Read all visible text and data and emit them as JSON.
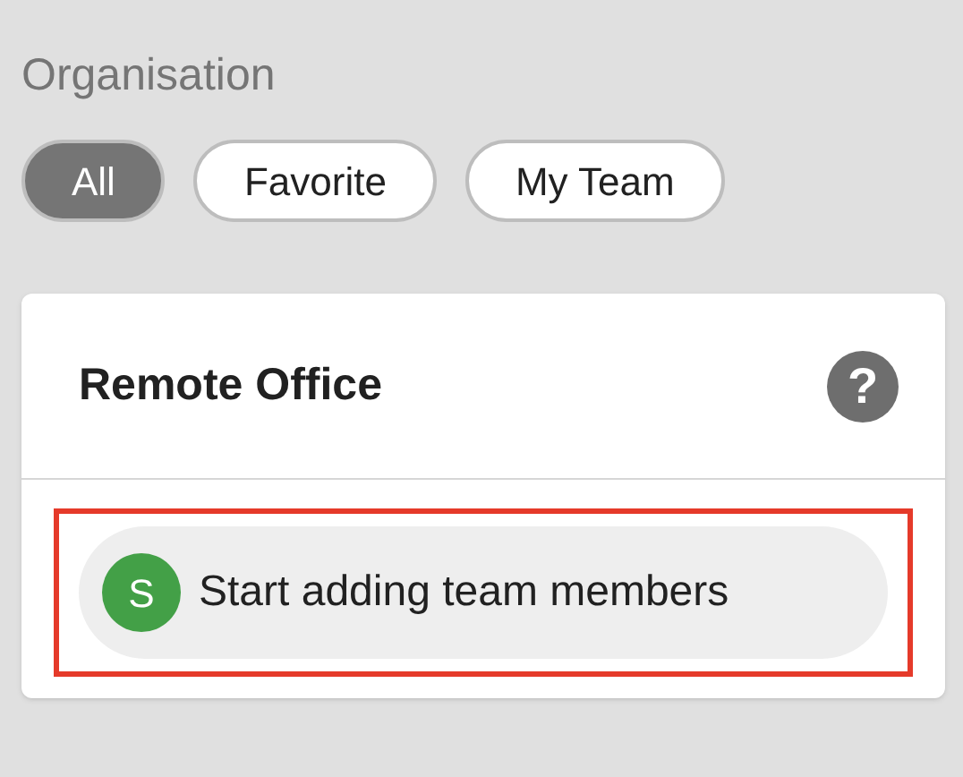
{
  "section_title": "Organisation",
  "filters": [
    {
      "label": "All",
      "selected": true
    },
    {
      "label": "Favorite",
      "selected": false
    },
    {
      "label": "My Team",
      "selected": false
    }
  ],
  "card": {
    "title": "Remote Office",
    "help_icon": "?",
    "members": [
      {
        "initial": "S",
        "label": "Start adding team members",
        "color": "#43a047",
        "highlighted": true
      }
    ]
  }
}
